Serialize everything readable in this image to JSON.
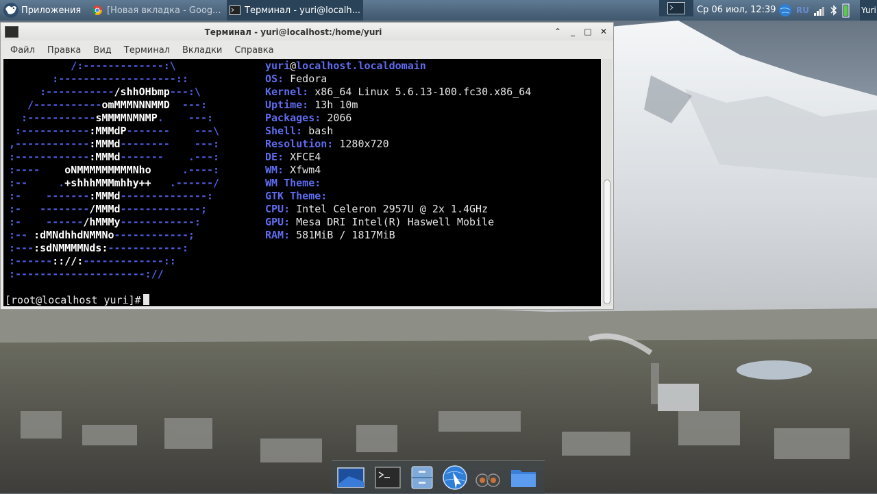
{
  "top_panel": {
    "apps_menu_label": "Приложения",
    "tasks": [
      {
        "label": "[Новая вкладка - Goog...",
        "icon": "chrome-icon"
      },
      {
        "label": "Терминал - yuri@localh...",
        "icon": "terminal-icon"
      }
    ],
    "clock": "Ср 06 июл, 12:39",
    "keyboard_layout": "RU",
    "user": "Yuri"
  },
  "window": {
    "title": "Терминал - yuri@localhost:/home/yuri",
    "menu": [
      "Файл",
      "Правка",
      "Вид",
      "Терминал",
      "Вкладки",
      "Справка"
    ]
  },
  "terminal": {
    "logo_lines": [
      [
        [
          "b",
          "          /:-------------:\\"
        ]
      ],
      [
        [
          "b",
          "       :-------------------::"
        ]
      ],
      [
        [
          "b",
          "     :-----------"
        ],
        [
          "w",
          "/shhOHbmp"
        ],
        [
          "b",
          "---:\\"
        ]
      ],
      [
        [
          "b",
          "   /-----------"
        ],
        [
          "w",
          "omMMMNNNMMD"
        ],
        [
          "b",
          "  ---:"
        ]
      ],
      [
        [
          "b",
          "  :-----------"
        ],
        [
          "w",
          "sMMMMNMNMP"
        ],
        [
          "b",
          ".    ---:"
        ]
      ],
      [
        [
          "b",
          " :-----------"
        ],
        [
          "w",
          ":MMMdP"
        ],
        [
          "b",
          "-------    ---\\"
        ]
      ],
      [
        [
          "b",
          ",------------"
        ],
        [
          "w",
          ":MMMd"
        ],
        [
          "b",
          "--------    ---:"
        ]
      ],
      [
        [
          "b",
          ":------------"
        ],
        [
          "w",
          ":MMMd"
        ],
        [
          "b",
          "-------    .---:"
        ]
      ],
      [
        [
          "b",
          ":----    "
        ],
        [
          "w",
          "oNMMMMMMMMMNho"
        ],
        [
          "b",
          "     .----:"
        ]
      ],
      [
        [
          "b",
          ":--     ."
        ],
        [
          "w",
          "+shhhMMMmhhy++"
        ],
        [
          "b",
          "   .------/"
        ]
      ],
      [
        [
          "b",
          ":-    -------"
        ],
        [
          "w",
          ":MMMd"
        ],
        [
          "b",
          "--------------:"
        ]
      ],
      [
        [
          "b",
          ":-   --------"
        ],
        [
          "w",
          "/MMMd"
        ],
        [
          "b",
          "-------------;"
        ]
      ],
      [
        [
          "b",
          ":-    ------"
        ],
        [
          "w",
          "/hMMMy"
        ],
        [
          "b",
          "------------:"
        ]
      ],
      [
        [
          "b",
          ":-- "
        ],
        [
          "w",
          ":dMNdhhdNMMNo"
        ],
        [
          "b",
          "------------;"
        ]
      ],
      [
        [
          "b",
          ":---"
        ],
        [
          "w",
          ":sdNMMMMNds:"
        ],
        [
          "b",
          "------------:"
        ]
      ],
      [
        [
          "b",
          ":------"
        ],
        [
          "w",
          ":://:"
        ],
        [
          "b",
          "-------------::"
        ]
      ],
      [
        [
          "b",
          ":---------------------://"
        ]
      ]
    ],
    "host_user": "yuri",
    "host_at": "@",
    "host_name": "localhost.localdomain",
    "info": [
      {
        "key": "OS:",
        "value": "Fedora"
      },
      {
        "key": "Kernel:",
        "value": "x86_64 Linux 5.6.13-100.fc30.x86_64"
      },
      {
        "key": "Uptime:",
        "value": "13h 10m"
      },
      {
        "key": "Packages:",
        "value": "2066"
      },
      {
        "key": "Shell:",
        "value": "bash"
      },
      {
        "key": "Resolution:",
        "value": "1280x720"
      },
      {
        "key": "DE:",
        "value": "XFCE4"
      },
      {
        "key": "WM:",
        "value": "Xfwm4"
      },
      {
        "key": "WM Theme:",
        "value": ""
      },
      {
        "key": "GTK Theme:",
        "value": ""
      },
      {
        "key": "CPU:",
        "value": "Intel Celeron 2957U @ 2x 1.4GHz"
      },
      {
        "key": "GPU:",
        "value": "Mesa DRI Intel(R) Haswell Mobile"
      },
      {
        "key": "RAM:",
        "value": "581MiB / 1817MiB"
      }
    ],
    "prompt": "[root@localhost yuri]#"
  },
  "dock": [
    {
      "name": "desktop-icon"
    },
    {
      "name": "terminal-icon"
    },
    {
      "name": "file-manager-icon"
    },
    {
      "name": "browser-icon"
    },
    {
      "name": "app-finder-icon"
    },
    {
      "name": "folder-icon"
    }
  ],
  "colors": {
    "panel": "#4a6480",
    "terminal_bg": "#000000",
    "logo_blue": "#5161e5",
    "info_key": "#5f6cf0"
  }
}
